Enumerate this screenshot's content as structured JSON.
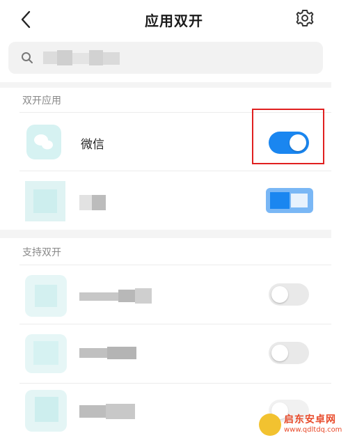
{
  "header": {
    "title": "应用双开",
    "back_icon": "chevron-left-icon",
    "settings_icon": "gear-icon"
  },
  "search": {
    "icon": "search-icon",
    "value": ""
  },
  "sections": {
    "dual_apps": {
      "title": "双开应用",
      "items": [
        {
          "name": "微信",
          "enabled": true
        },
        {
          "name": "",
          "enabled": true
        }
      ]
    },
    "supported": {
      "title": "支持双开",
      "items": [
        {
          "name": "",
          "enabled": false
        },
        {
          "name": "",
          "enabled": false
        },
        {
          "name": "",
          "enabled": false
        }
      ]
    }
  },
  "watermark": {
    "text": "启东安卓网",
    "url": "www.qdltdq.com"
  },
  "colors": {
    "toggle_on": "#1a86f0",
    "toggle_off": "#e9e9e9",
    "highlight": "#e02020",
    "app_icon": "#d4f1f1"
  }
}
